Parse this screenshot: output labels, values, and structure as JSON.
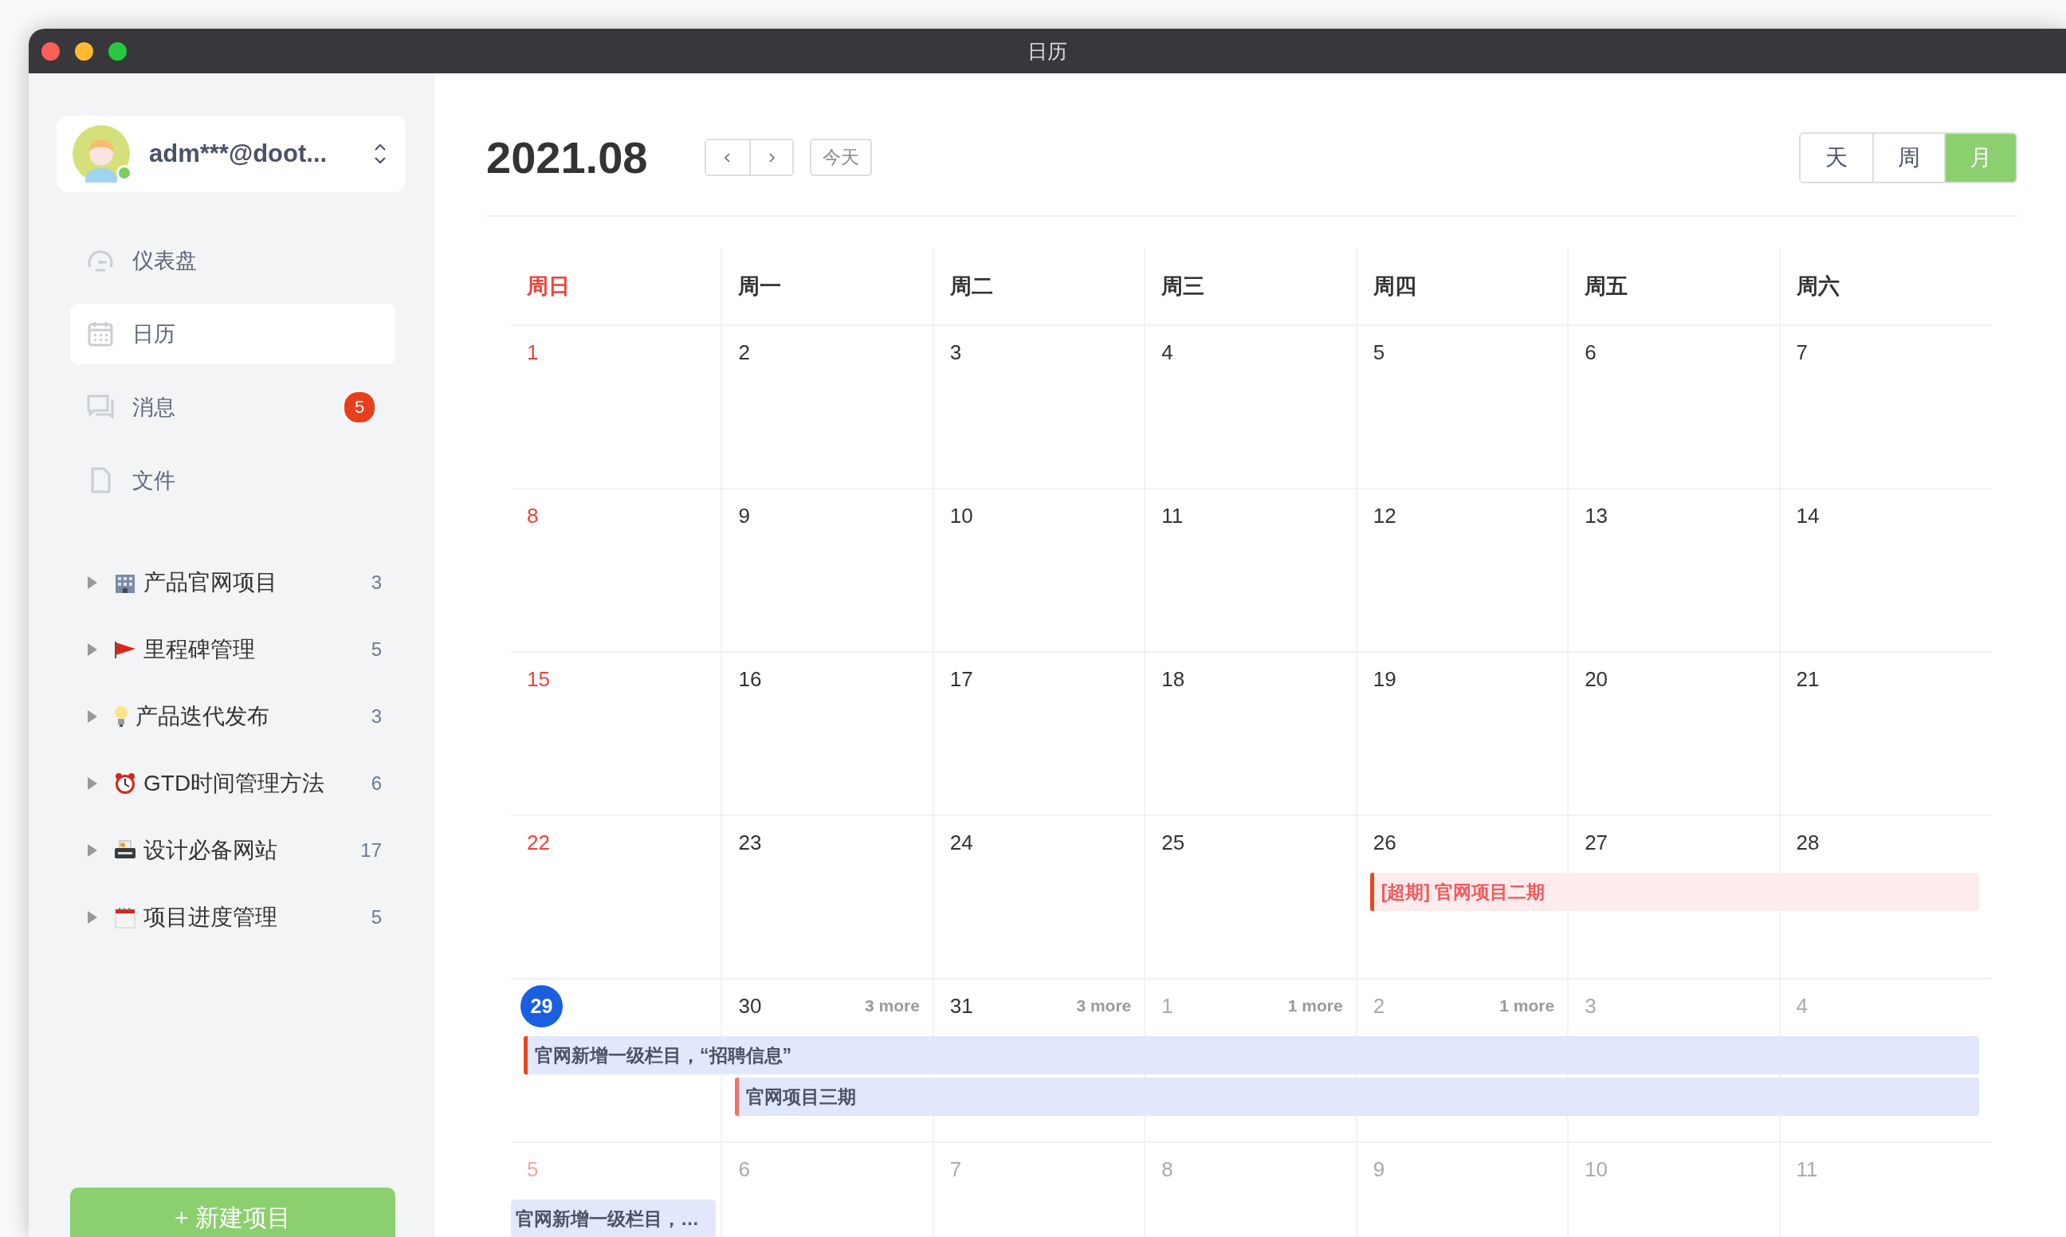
{
  "window": {
    "title": "日历"
  },
  "account": {
    "name": "adm***@doot...",
    "online": true
  },
  "nav": [
    {
      "label": "仪表盘",
      "kind": "dashboard",
      "selected": false
    },
    {
      "label": "日历",
      "kind": "calendar",
      "selected": true
    },
    {
      "label": "消息",
      "kind": "messages",
      "selected": false,
      "badge": "5"
    },
    {
      "label": "文件",
      "kind": "file",
      "selected": false
    }
  ],
  "projects": [
    {
      "name": "产品官网项目",
      "kind": "building",
      "count": "3",
      "expanded": false
    },
    {
      "name": "里程碑管理",
      "kind": "flag",
      "count": "5",
      "expanded": false
    },
    {
      "name": "产品迭代发布",
      "kind": "bulb",
      "count": "3",
      "expanded": false
    },
    {
      "name": "GTD时间管理方法",
      "kind": "alarm",
      "count": "6",
      "expanded": false
    },
    {
      "name": "设计必备网站",
      "kind": "printer",
      "count": "17",
      "expanded": false
    },
    {
      "name": "项目进度管理",
      "kind": "calendar",
      "count": "5",
      "expanded": false
    }
  ],
  "new_project_button": "+ 新建项目",
  "calendar": {
    "month": "2021.08",
    "today_button": "今天",
    "views": [
      {
        "label": "天",
        "selected": false
      },
      {
        "label": "周",
        "selected": false
      },
      {
        "label": "月",
        "selected": true
      }
    ],
    "weekdays": [
      {
        "label": "周日",
        "weekend": true
      },
      {
        "label": "周一",
        "weekend": false
      },
      {
        "label": "周二",
        "weekend": false
      },
      {
        "label": "周三",
        "weekend": false
      },
      {
        "label": "周四",
        "weekend": false
      },
      {
        "label": "周五",
        "weekend": false
      },
      {
        "label": "周六",
        "weekend": false
      }
    ],
    "weeks": [
      {
        "days": [
          {
            "day": "1",
            "in_month": true,
            "today": false
          },
          {
            "day": "2",
            "in_month": true,
            "today": false
          },
          {
            "day": "3",
            "in_month": true,
            "today": false
          },
          {
            "day": "4",
            "in_month": true,
            "today": false
          },
          {
            "day": "5",
            "in_month": true,
            "today": false
          },
          {
            "day": "6",
            "in_month": true,
            "today": false
          },
          {
            "day": "7",
            "in_month": true,
            "today": false
          }
        ]
      },
      {
        "days": [
          {
            "day": "8",
            "in_month": true,
            "today": false
          },
          {
            "day": "9",
            "in_month": true,
            "today": false
          },
          {
            "day": "10",
            "in_month": true,
            "today": false
          },
          {
            "day": "11",
            "in_month": true,
            "today": false
          },
          {
            "day": "12",
            "in_month": true,
            "today": false
          },
          {
            "day": "13",
            "in_month": true,
            "today": false
          },
          {
            "day": "14",
            "in_month": true,
            "today": false
          }
        ]
      },
      {
        "days": [
          {
            "day": "15",
            "in_month": true,
            "today": false
          },
          {
            "day": "16",
            "in_month": true,
            "today": false
          },
          {
            "day": "17",
            "in_month": true,
            "today": false
          },
          {
            "day": "18",
            "in_month": true,
            "today": false
          },
          {
            "day": "19",
            "in_month": true,
            "today": false
          },
          {
            "day": "20",
            "in_month": true,
            "today": false
          },
          {
            "day": "21",
            "in_month": true,
            "today": false
          }
        ]
      },
      {
        "days": [
          {
            "day": "22",
            "in_month": true,
            "today": false
          },
          {
            "day": "23",
            "in_month": true,
            "today": false
          },
          {
            "day": "24",
            "in_month": true,
            "today": false
          },
          {
            "day": "25",
            "in_month": true,
            "today": false
          },
          {
            "day": "26",
            "in_month": true,
            "today": false,
            "events": [
              {
                "text": "[超期] 官网项目二期",
                "kind": "overdue",
                "color": "#e8461e",
                "to_week_end": true
              }
            ]
          },
          {
            "day": "27",
            "in_month": true,
            "today": false
          },
          {
            "day": "28",
            "in_month": true,
            "today": false
          }
        ]
      },
      {
        "days": [
          {
            "day": "29",
            "in_month": true,
            "today": true,
            "events": [
              {
                "text": "官网新增一级栏目，“招聘信息”",
                "kind": "normal",
                "color": "#e8461e",
                "to_week_end": true
              }
            ]
          },
          {
            "day": "30",
            "in_month": true,
            "today": false,
            "more": "3 more",
            "events": [
              {
                "text": "官网项目三期",
                "kind": "normal",
                "color": "#f07167",
                "to_week_end": true
              }
            ]
          },
          {
            "day": "31",
            "in_month": true,
            "today": false,
            "more": "3 more"
          },
          {
            "day": "1",
            "in_month": false,
            "today": false,
            "more": "1 more"
          },
          {
            "day": "2",
            "in_month": false,
            "today": false,
            "more": "1 more"
          },
          {
            "day": "3",
            "in_month": false,
            "today": false
          },
          {
            "day": "4",
            "in_month": false,
            "today": false
          }
        ]
      },
      {
        "days": [
          {
            "day": "5",
            "in_month": false,
            "today": false,
            "events": [
              {
                "text": "官网新增一级栏目，…",
                "kind": "normal",
                "to_week_end": false
              }
            ]
          },
          {
            "day": "6",
            "in_month": false,
            "today": false
          },
          {
            "day": "7",
            "in_month": false,
            "today": false
          },
          {
            "day": "8",
            "in_month": false,
            "today": false
          },
          {
            "day": "9",
            "in_month": false,
            "today": false
          },
          {
            "day": "10",
            "in_month": false,
            "today": false
          },
          {
            "day": "11",
            "in_month": false,
            "today": false
          }
        ]
      }
    ]
  }
}
